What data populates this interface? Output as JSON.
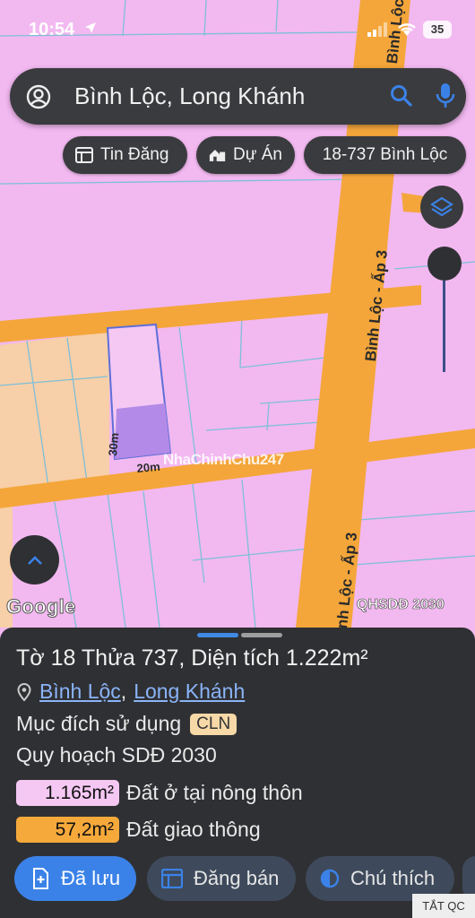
{
  "status_bar": {
    "time": "10:54",
    "battery": "35"
  },
  "search": {
    "query": "Bình Lộc, Long Khánh"
  },
  "chips": [
    {
      "label": "Tin Đăng"
    },
    {
      "label": "Dự Án"
    },
    {
      "label": "18-737 Bình Lộc"
    }
  ],
  "map": {
    "road_labels": [
      "Bình Lộc - Ấp 3",
      "Bình Lộc",
      "nh Lộc - Ấp 3"
    ],
    "dimension_width": "20m",
    "dimension_depth": "30m",
    "watermark": "NhaChinhChu247",
    "google_logo": "Google",
    "plan_badge": "QHSDĐ 2030"
  },
  "sheet": {
    "title": "Tờ 18 Thửa 737, Diện tích 1.222m²",
    "ward": "Bình Lộc",
    "separator": ",",
    "city": "Long Khánh",
    "purpose_label": "Mục đích sử dụng",
    "purpose_tag": "CLN",
    "plan_label": "Quy hoạch SDĐ 2030",
    "areas": [
      {
        "value": "1.165m²",
        "label": "Đất ở tại nông thôn",
        "color": "#f5c8f3"
      },
      {
        "value": "57,2m²",
        "label": "Đất giao thông",
        "color": "#f6a93b"
      }
    ],
    "buttons": {
      "saved": "Đã lưu",
      "sell": "Đăng bán",
      "legend": "Chú thích"
    },
    "ad_off": "TẮT QC"
  },
  "colors": {
    "land_pink": "#f2b8f0",
    "road_orange": "#f4a63a",
    "parcel_purple": "#b48ae8",
    "accent_blue": "#3b82e8"
  }
}
